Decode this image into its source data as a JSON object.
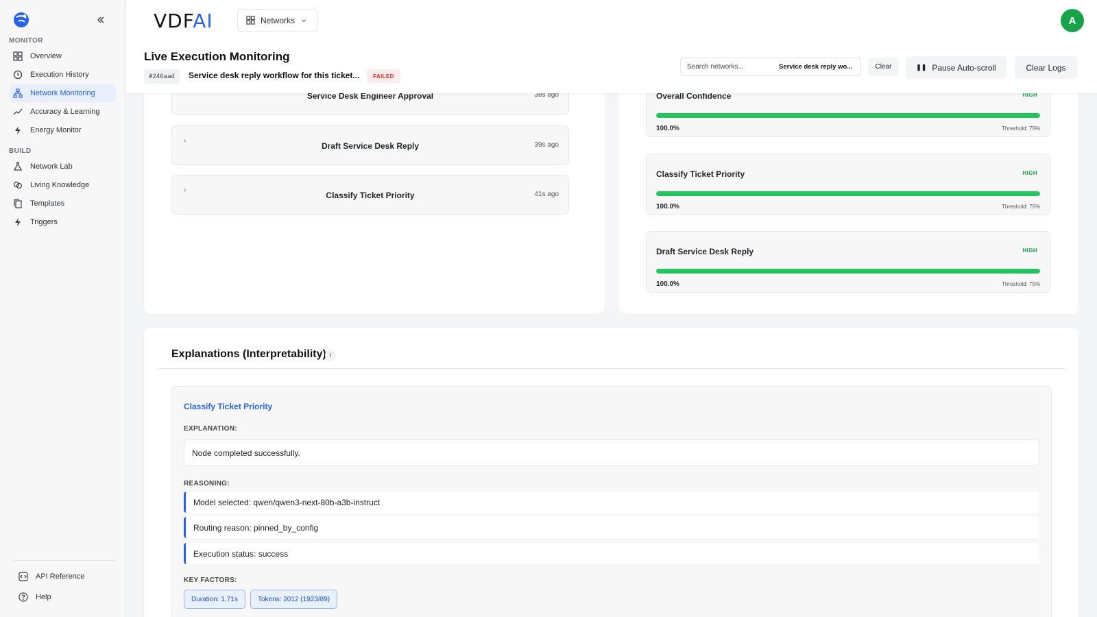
{
  "sidebar": {
    "sections": [
      {
        "label": "MONITOR"
      },
      {
        "label": "BUILD"
      }
    ],
    "items": [
      {
        "label": "Overview",
        "icon": "grid-icon"
      },
      {
        "label": "Execution History",
        "icon": "history-icon"
      },
      {
        "label": "Network Monitoring",
        "icon": "network-icon",
        "active": true
      },
      {
        "label": "Accuracy & Learning",
        "icon": "trend-icon"
      },
      {
        "label": "Energy Monitor",
        "icon": "bolt-icon"
      },
      {
        "label": "Network Lab",
        "icon": "flask-icon"
      },
      {
        "label": "Living Knowledge",
        "icon": "brain-icon"
      },
      {
        "label": "Templates",
        "icon": "copy-icon"
      },
      {
        "label": "Triggers",
        "icon": "bolt-icon"
      }
    ],
    "footer": [
      {
        "label": "API Reference",
        "icon": "code-icon"
      },
      {
        "label": "Help",
        "icon": "help-icon"
      }
    ]
  },
  "header": {
    "brand_main": "VDF",
    "brand_accent": "AI",
    "networks_label": "Networks",
    "avatar_letter": "A",
    "title": "Live Execution Monitoring",
    "execution_id": "#246aad",
    "execution_name": "Service desk reply workflow for this ticket...",
    "status": "FAILED",
    "search_placeholder": "Search networks...",
    "search_selected": "Service desk reply wo...",
    "clear_label": "Clear",
    "pause_label": "Pause Auto-scroll",
    "clear_logs_label": "Clear Logs"
  },
  "colors": {
    "accent": "#2563eb",
    "success": "#22c55e",
    "failed": "#dc2626"
  },
  "executions": [
    {
      "title": "Service Desk Engineer Approval",
      "time": "38s ago"
    },
    {
      "title": "Draft Service Desk Reply",
      "time": "39s ago"
    },
    {
      "title": "Classify Ticket Priority",
      "time": "41s ago"
    }
  ],
  "confidence": [
    {
      "name": "Overall Confidence",
      "level": "HIGH",
      "percent": "100.0%",
      "fill": 1.0,
      "threshold": "Threshold: 75%"
    },
    {
      "name": "Classify Ticket Priority",
      "level": "HIGH",
      "percent": "100.0%",
      "fill": 1.0,
      "threshold": "Threshold: 75%"
    },
    {
      "name": "Draft Service Desk Reply",
      "level": "HIGH",
      "percent": "100.0%",
      "fill": 1.0,
      "threshold": "Threshold: 75%"
    }
  ],
  "explanations": {
    "title": "Explanations (Interpretability)",
    "info": "i",
    "node": "Classify Ticket Priority",
    "explanation_label": "EXPLANATION:",
    "explanation_text": "Node completed successfully.",
    "reasoning_label": "REASONING:",
    "reasoning": [
      "Model selected: qwen/qwen3-next-80b-a3b-instruct",
      "Routing reason: pinned_by_config",
      "Execution status: success"
    ],
    "key_factors_label": "KEY FACTORS:",
    "key_factors": [
      "Duration: 1.71s",
      "Tokens: 2012 (1923/89)"
    ]
  }
}
